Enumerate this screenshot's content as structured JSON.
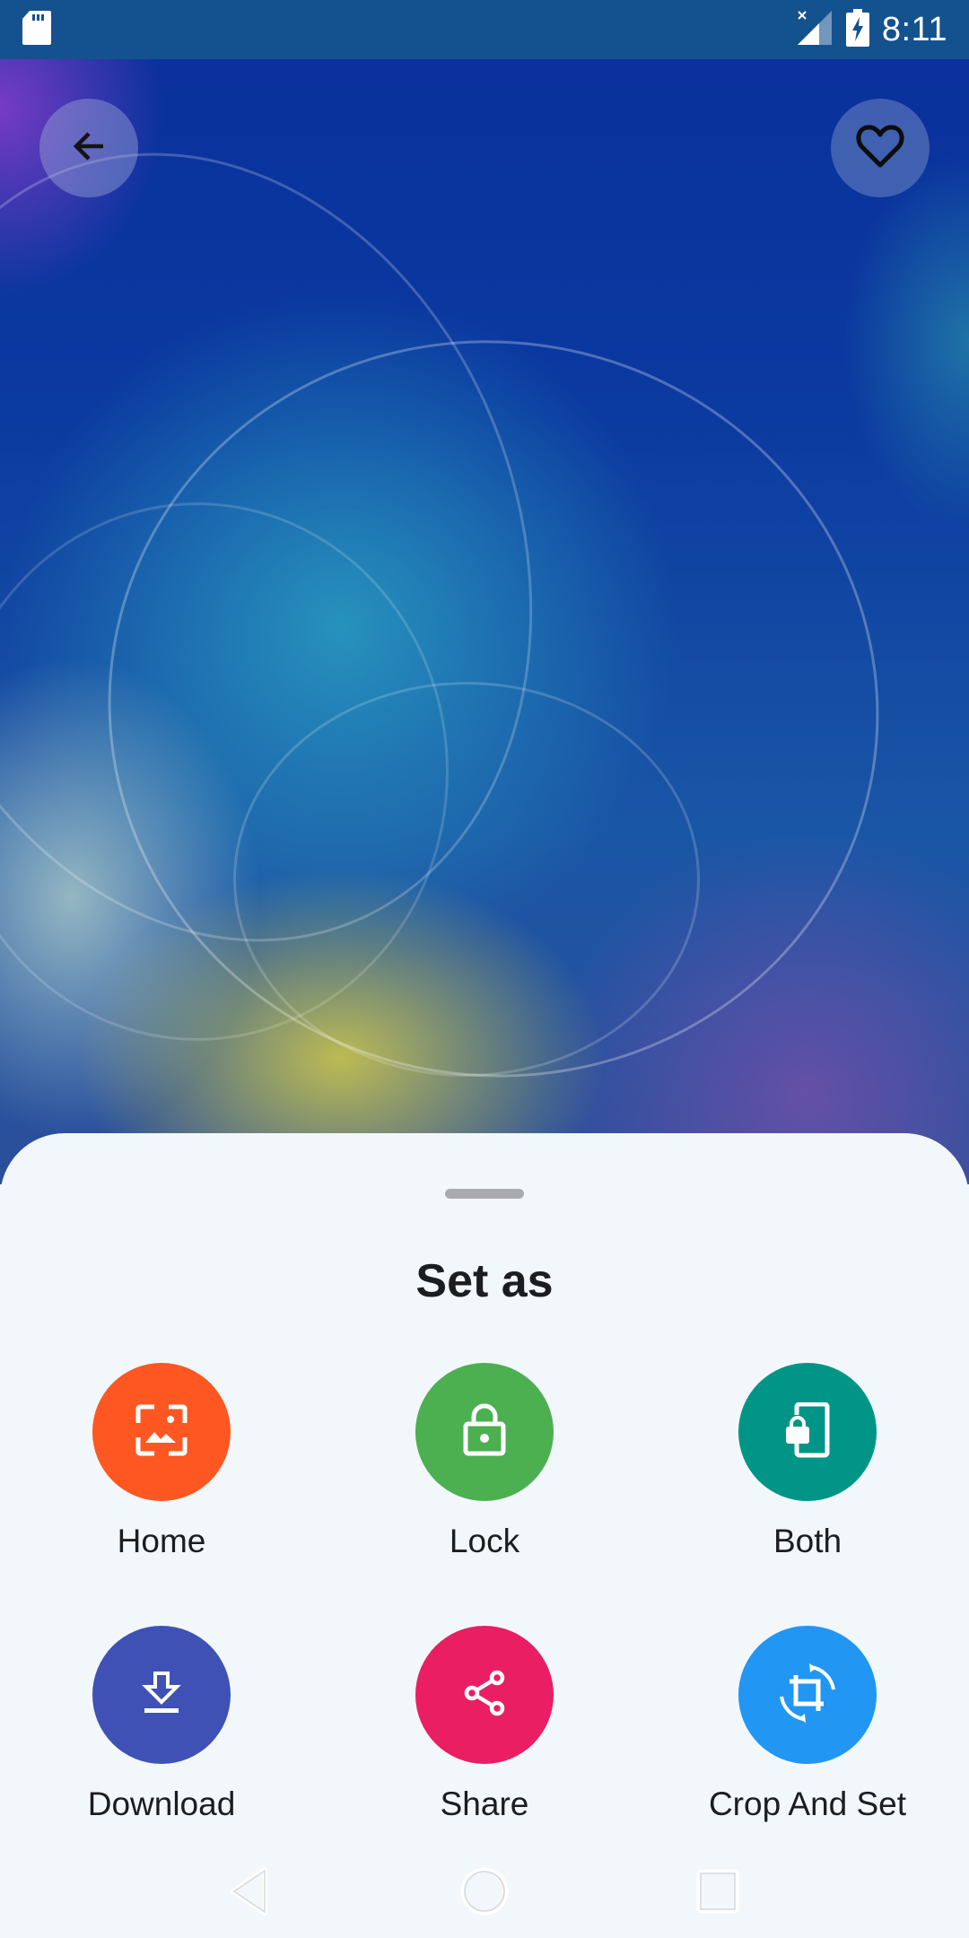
{
  "status_bar": {
    "time": "8:11",
    "icons": [
      "sd-card-icon",
      "signal-no-service-icon",
      "battery-charging-icon"
    ]
  },
  "toolbar": {
    "back_icon": "arrow-back-icon",
    "favorite_icon": "heart-outline-icon"
  },
  "sheet": {
    "title": "Set as",
    "options": [
      {
        "label": "Home",
        "icon": "wallpaper-icon",
        "color": "#fe5722"
      },
      {
        "label": "Lock",
        "icon": "lock-icon",
        "color": "#4caf50"
      },
      {
        "label": "Both",
        "icon": "phone-lock-icon",
        "color": "#009587"
      },
      {
        "label": "Download",
        "icon": "download-icon",
        "color": "#3f51b5"
      },
      {
        "label": "Share",
        "icon": "share-icon",
        "color": "#e91e63"
      },
      {
        "label": "Crop And Set",
        "icon": "crop-rotate-icon",
        "color": "#2196f3"
      }
    ]
  },
  "nav_bar": {
    "buttons": [
      "nav-back-icon",
      "nav-home-icon",
      "nav-recents-icon"
    ]
  }
}
